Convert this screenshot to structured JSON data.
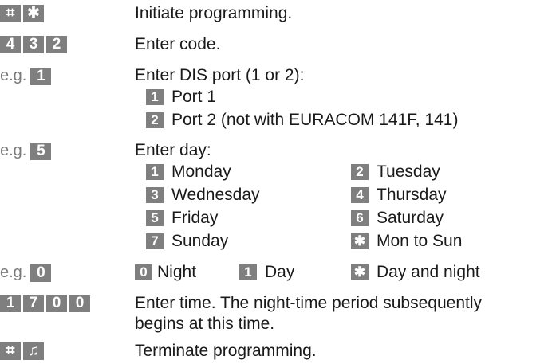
{
  "steps": {
    "start": {
      "keys": [
        "⌗",
        "✱"
      ],
      "text": "Initiate programming."
    },
    "code": {
      "keys": [
        "4",
        "3",
        "2"
      ],
      "text": "Enter code."
    },
    "port": {
      "eg": "e.g.",
      "key": "1",
      "text": "Enter DIS port (1 or 2):",
      "options": [
        {
          "key": "1",
          "label": "Port 1"
        },
        {
          "key": "2",
          "label": "Port 2 (not with EURACOM 141F, 141)"
        }
      ]
    },
    "day": {
      "eg": "e.g.",
      "key": "5",
      "text": "Enter day:",
      "options": [
        {
          "key": "1",
          "label": "Monday"
        },
        {
          "key": "2",
          "label": "Tuesday"
        },
        {
          "key": "3",
          "label": "Wednesday"
        },
        {
          "key": "4",
          "label": "Thursday"
        },
        {
          "key": "5",
          "label": "Friday"
        },
        {
          "key": "6",
          "label": "Saturday"
        },
        {
          "key": "7",
          "label": "Sunday"
        },
        {
          "key": "✱",
          "label": "Mon to Sun"
        }
      ]
    },
    "period": {
      "eg": "e.g.",
      "key": "0",
      "options": [
        {
          "key": "0",
          "label": "Night"
        },
        {
          "key": "1",
          "label": "Day"
        },
        {
          "key": "✱",
          "label": "Day and night"
        }
      ]
    },
    "time": {
      "keys": [
        "1",
        "7",
        "0",
        "0"
      ],
      "text_line1": "Enter time. The night-time period subsequently",
      "text_line2": "begins at this time."
    },
    "end": {
      "keys": [
        "⌗",
        "♫"
      ],
      "text": "Terminate programming."
    }
  }
}
